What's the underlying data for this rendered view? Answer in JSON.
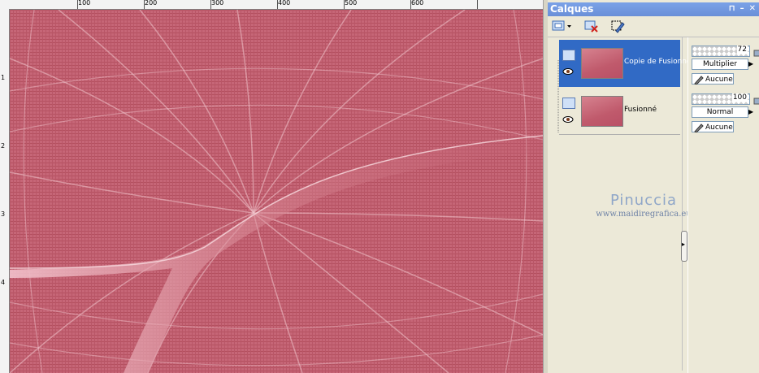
{
  "ruler": {
    "top_labels": [
      "100",
      "200",
      "300",
      "400",
      "500",
      "600"
    ],
    "left_labels": [
      "1",
      "2",
      "3",
      "4"
    ]
  },
  "panel": {
    "title": "Calques",
    "pin_icon": "pin-icon",
    "close_icon": "close-icon"
  },
  "toolbar": {
    "new_layer_icon": "new-raster-layer-icon",
    "delete_icon": "delete-layer-icon",
    "edit_icon": "edit-selection-icon"
  },
  "layers": [
    {
      "name": "Copie de Fusionné",
      "selected": true,
      "opacity": "72",
      "blend_mode": "Multiplier",
      "lock": "Aucune"
    },
    {
      "name": "Fusionné",
      "selected": false,
      "opacity": "100",
      "blend_mode": "Normal",
      "lock": "Aucune"
    }
  ],
  "watermark": {
    "name": "Pinuccia",
    "url": "www.maidiregrafica.eu"
  },
  "colors": {
    "canvas": "#c25e70",
    "selection": "#316ac5",
    "title_bar": "#7ba2e7",
    "panel_bg": "#ece9d8"
  }
}
